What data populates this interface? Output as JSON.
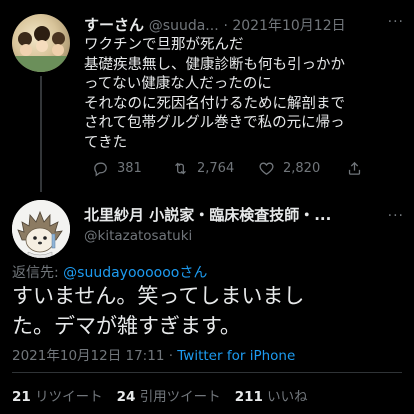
{
  "tweet1": {
    "name": "すーさん",
    "handle": "@suuda...",
    "date": "2021年10月12日",
    "more": "···",
    "lines": [
      "ワクチンで旦那が死んだ",
      "基礎疾患無し、健康診断も何も引っかか",
      "ってない健康な人だったのに",
      "それなのに死因名付けるために解剖まで",
      "されて包帯グルグル巻きで私の元に帰っ",
      "てきた"
    ],
    "replies": "381",
    "retweets": "2,764",
    "likes": "2,820"
  },
  "tweet2": {
    "name": "北里紗月 小説家・臨床検査技師・...",
    "handle": "@kitazatosatuki",
    "more": "···",
    "reply_prefix": "返信先: ",
    "reply_handle": "@suudayoooooo",
    "reply_suffix": "さん",
    "line1": "すいません。笑ってしまいまし",
    "line2": "た。デマが雑すぎます。",
    "timestamp": "2021年10月12日 17:11 · ",
    "source": "Twitter for iPhone",
    "stats": {
      "retweets_count": "21",
      "retweets_label": "リツイート",
      "quotes_count": "24",
      "quotes_label": "引用ツイート",
      "likes_count": "211",
      "likes_label": "いいね"
    }
  },
  "colors": {
    "background": "#000000",
    "text": "#e7e9ea",
    "muted": "#71767b",
    "link": "#1d9bf0"
  }
}
